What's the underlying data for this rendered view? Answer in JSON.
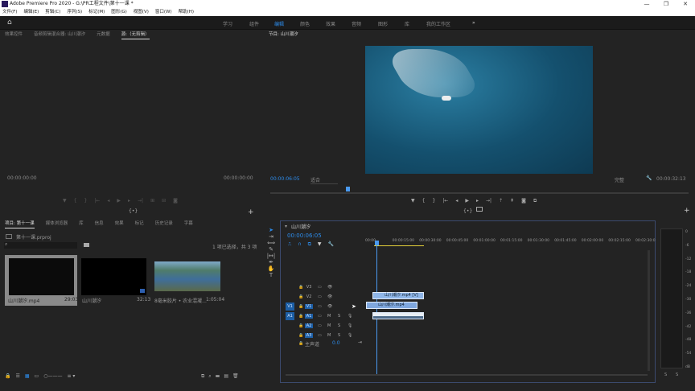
{
  "app": {
    "title": "Adobe Premiere Pro 2020 - G:\\PR工程文件\\第十一课 *",
    "logo": "Pr",
    "window_buttons": [
      "—",
      "❐",
      "✕"
    ]
  },
  "menu": [
    "文件(F)",
    "编辑(E)",
    "剪辑(C)",
    "序列(S)",
    "标记(M)",
    "图形(G)",
    "视图(V)",
    "窗口(W)",
    "帮助(H)"
  ],
  "workspaces": [
    "学习",
    "组件",
    "编辑",
    "颜色",
    "效果",
    "音频",
    "图形",
    "库",
    "我的工作区",
    "»"
  ],
  "active_workspace": "编辑",
  "source_panel": {
    "tabs": [
      "效果控件",
      "音频剪辑混合器: 山川潮汐",
      "元数据",
      "源:（无剪辑）"
    ],
    "timecode_left": "00:00:00:00",
    "timecode_right": "00:00:00:00"
  },
  "program_panel": {
    "title": "节目: 山川潮汐",
    "timecode": "00:00:06:05",
    "fit": "适合",
    "quality": "完整",
    "duration": "00:00:32:13",
    "playhead_fraction": 0.18
  },
  "project_panel": {
    "tabs": [
      "项目: 第十一课",
      "媒体浏览器",
      "库",
      "信息",
      "效果",
      "标记",
      "历史记录",
      "字幕"
    ],
    "project_file": "第十一课.prproj",
    "search_placeholder": "",
    "selection_status": "1 项已选择，共 3 项",
    "items": [
      {
        "name": "山川潮汐.mp4",
        "duration": "29:03"
      },
      {
        "name": "山川潮汐",
        "duration": "32:13"
      },
      {
        "name": "8毫米胶片 • 农业混凝...",
        "duration": "1:05:04"
      }
    ]
  },
  "timeline": {
    "title": "山川潮汐",
    "timecode": "00:00:06:05",
    "ruler": [
      "00:00",
      "00:00:15:00",
      "00:00:30:00",
      "00:00:45:00",
      "00:01:00:00",
      "00:01:15:00",
      "00:01:30:00",
      "00:01:45:00",
      "00:02:00:00",
      "00:02:15:00",
      "00:02:30:0"
    ],
    "video_tracks": [
      "V3",
      "V2",
      "V1"
    ],
    "audio_tracks": [
      "A1",
      "A2",
      "A3"
    ],
    "source_v": "V1",
    "source_a": "A1",
    "mix_label": "主声道",
    "mix_value": "0.0",
    "mute": "M",
    "solo": "S",
    "clips": {
      "video_top": "山川潮汐.mp4 [V]",
      "video_drag": "山川潮汐.mp4"
    }
  },
  "meter": {
    "scale": [
      "0",
      "-6",
      "-12",
      "-18",
      "-24",
      "-30",
      "-36",
      "-42",
      "-48",
      "-54",
      "dB"
    ],
    "solo": [
      "S",
      "S"
    ]
  }
}
